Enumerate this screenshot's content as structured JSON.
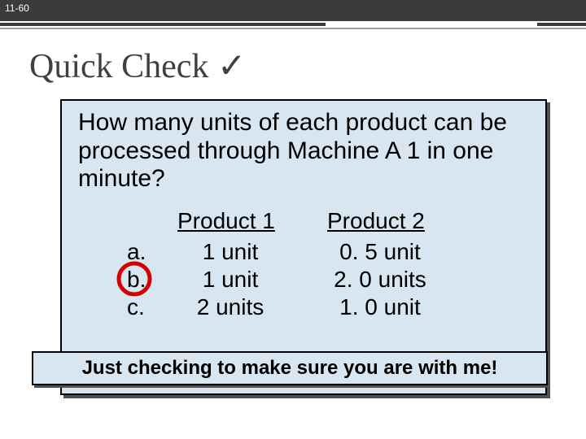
{
  "slide_number": "11-60",
  "title": "Quick Check",
  "check_glyph": "✓",
  "question": "How many units of each product can be processed through Machine A 1 in one minute?",
  "columns": {
    "p1": "Product 1",
    "p2": "Product 2"
  },
  "options": {
    "a": {
      "label": "a.",
      "p1": "1 unit",
      "p2": "0. 5 unit"
    },
    "b": {
      "label": "b.",
      "p1": "1 unit",
      "p2": "2. 0 units"
    },
    "c": {
      "label": "c.",
      "p1": "2 units",
      "p2": "1. 0 unit"
    }
  },
  "circled_option": "b",
  "footer": "Just checking to make sure you are with me!"
}
